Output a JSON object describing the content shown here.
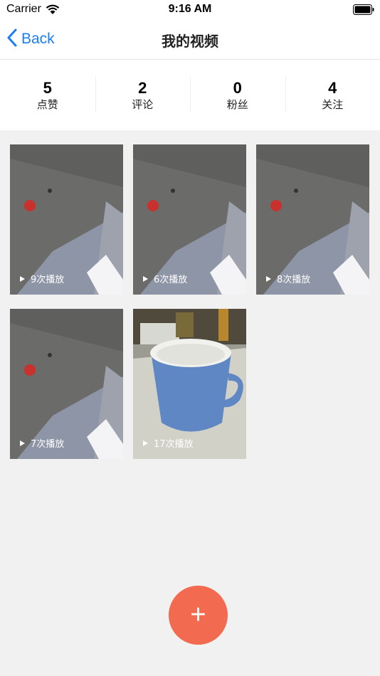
{
  "status_bar": {
    "carrier": "Carrier",
    "time": "9:16 AM"
  },
  "nav": {
    "back_label": "Back",
    "title": "我的视频"
  },
  "stats": [
    {
      "count": "5",
      "label": "点赞"
    },
    {
      "count": "2",
      "label": "评论"
    },
    {
      "count": "0",
      "label": "粉丝"
    },
    {
      "count": "4",
      "label": "关注"
    }
  ],
  "videos": [
    {
      "plays": "9次播放",
      "thumb": "ceiling"
    },
    {
      "plays": "6次播放",
      "thumb": "ceiling"
    },
    {
      "plays": "8次播放",
      "thumb": "ceiling"
    },
    {
      "plays": "7次播放",
      "thumb": "ceiling"
    },
    {
      "plays": "17次播放",
      "thumb": "mug"
    }
  ],
  "fab": {
    "label": "+",
    "color": "#f26a4f"
  },
  "colors": {
    "accent": "#1a7ef5",
    "background": "#f1f1f1"
  }
}
